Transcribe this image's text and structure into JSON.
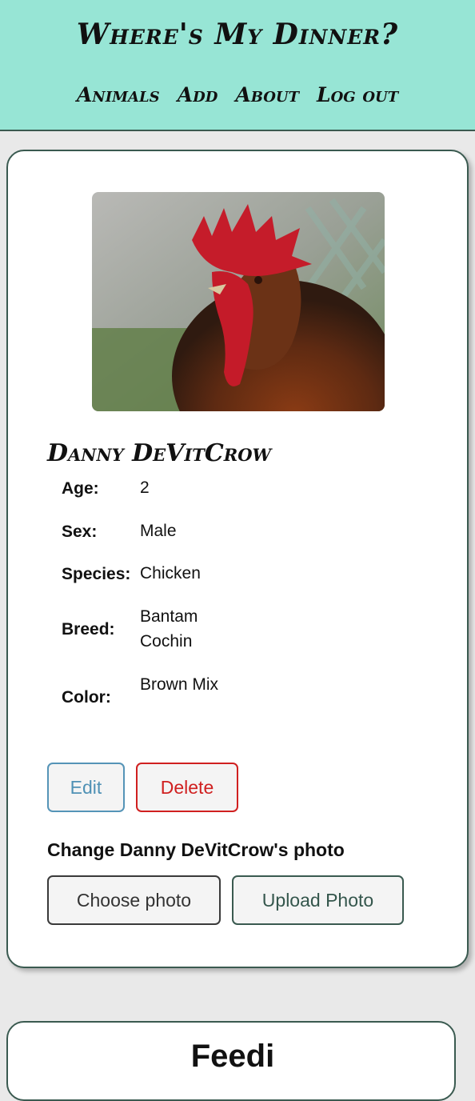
{
  "site": {
    "title": "Where's My Dinner?",
    "nav": [
      "Animals",
      "Add",
      "About",
      "Log out"
    ]
  },
  "animal": {
    "name": "Danny DeVitCrow",
    "photo_icon": "rooster-photo",
    "details": [
      {
        "label": "Age:",
        "value": "2"
      },
      {
        "label": "Sex:",
        "value": "Male"
      },
      {
        "label": "Species:",
        "value": "Chicken"
      },
      {
        "label": "Breed:",
        "value": "Bantam Cochin"
      },
      {
        "label": "Color:",
        "value": "Brown Mix"
      }
    ]
  },
  "actions": {
    "edit_label": "Edit",
    "delete_label": "Delete",
    "change_photo_label": "Change Danny DeVitCrow's photo",
    "choose_label": "Choose photo",
    "upload_label": "Upload Photo"
  },
  "next_section": {
    "title": "Feedi"
  },
  "colors": {
    "header_bg": "#97e5d5",
    "accent": "#3a5a50",
    "edit": "#4f91b5",
    "delete": "#d02020"
  }
}
